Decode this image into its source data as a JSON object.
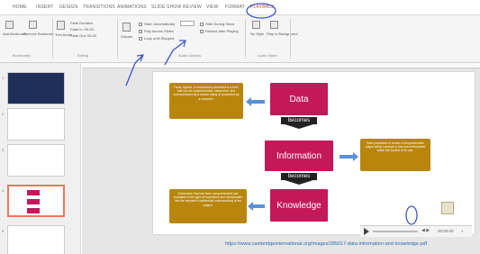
{
  "tabs": [
    "HOME",
    "INSERT",
    "DESIGN",
    "TRANSITIONS",
    "ANIMATIONS",
    "SLIDE SHOW",
    "REVIEW",
    "VIEW",
    "FORMAT",
    "PLAYBACK"
  ],
  "active_tab": "PLAYBACK",
  "ribbon": {
    "bookmarks": {
      "add_label": "Add Bookmark",
      "remove_label": "Remove Bookmark",
      "group": "Bookmarks"
    },
    "play": {
      "label": "Play"
    },
    "trim": {
      "label": "Trim Audio"
    },
    "editing": {
      "fade_duration": "Fade Duration",
      "fade_in": "Fade In: 00.00",
      "fade_out": "Fade Out: 00.00",
      "group": "Editing"
    },
    "volume": {
      "label": "Volume"
    },
    "audio_options": {
      "start_label": "Start: Automatically",
      "play_across": "Play Across Slides",
      "loop": "Loop until Stopped",
      "hide_during_show": "Hide During Show",
      "rewind": "Rewind after Playing",
      "group": "Audio Options"
    },
    "audio_styles": {
      "no_style": "No Style",
      "play_background": "Play in Background",
      "group": "Audio Styles"
    }
  },
  "slides_panel": {
    "numbers": [
      "1",
      "2",
      "3",
      "4",
      "5"
    ]
  },
  "slide": {
    "data_label": "Data",
    "information_label": "Information",
    "knowledge_label": "Knowledge",
    "becomes_1": "becomes",
    "becomes_2": "becomes",
    "data_desc": "Facts, figures, or instructions presented in a form that can be comprehended, interpreted, and communicated by a human being or processed by a computer.",
    "info_desc": "Data processed to create a comprehensible output which conveys or has been interpreted within the context of its use.",
    "knowledge_desc": "Information that has been comprehended and evaluated in the light of experience and incorporated into the recipient's intellectual understanding of the subject."
  },
  "media_bar": {
    "time": "00:00.00"
  },
  "source_url": "https://www.cambridgeinternational.org/Images/285017-data-information-and-knowledge.pdf",
  "colors": {
    "data_key": "#c4185a",
    "description_box": "#b8860b",
    "arrow": "#5b8fd6",
    "annotation_pen": "#3a55c8"
  }
}
